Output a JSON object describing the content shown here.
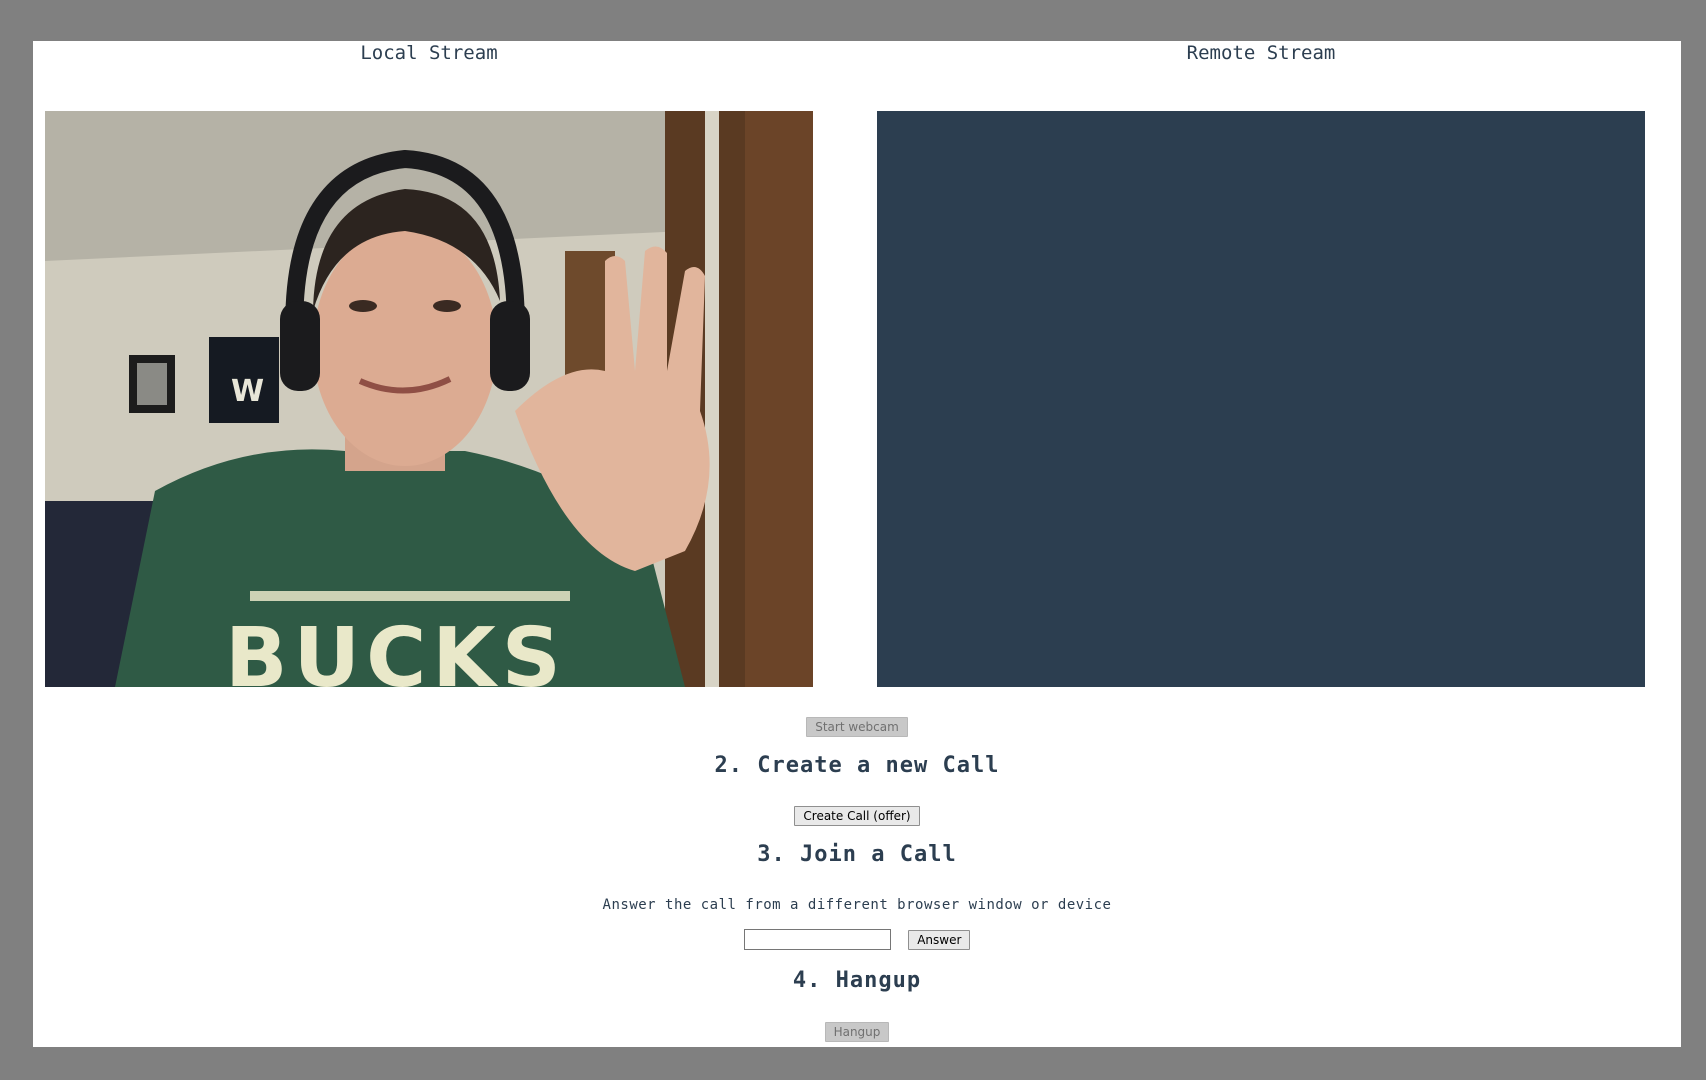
{
  "local_stream": {
    "heading": "Local Stream"
  },
  "remote_stream": {
    "heading": "Remote Stream"
  },
  "webcam": {
    "button_label": "Start webcam"
  },
  "create_call": {
    "title": "2. Create a new Call",
    "button_label": "Create Call (offer)"
  },
  "join_call": {
    "title": "3. Join a Call",
    "description": "Answer the call from a different browser window or device",
    "input_value": "",
    "button_label": "Answer"
  },
  "hangup": {
    "title": "4. Hangup",
    "button_label": "Hangup"
  },
  "colors": {
    "page_background": "#808080",
    "content_background": "#ffffff",
    "text": "#2c3e50",
    "remote_video_background": "#2c3e50"
  }
}
